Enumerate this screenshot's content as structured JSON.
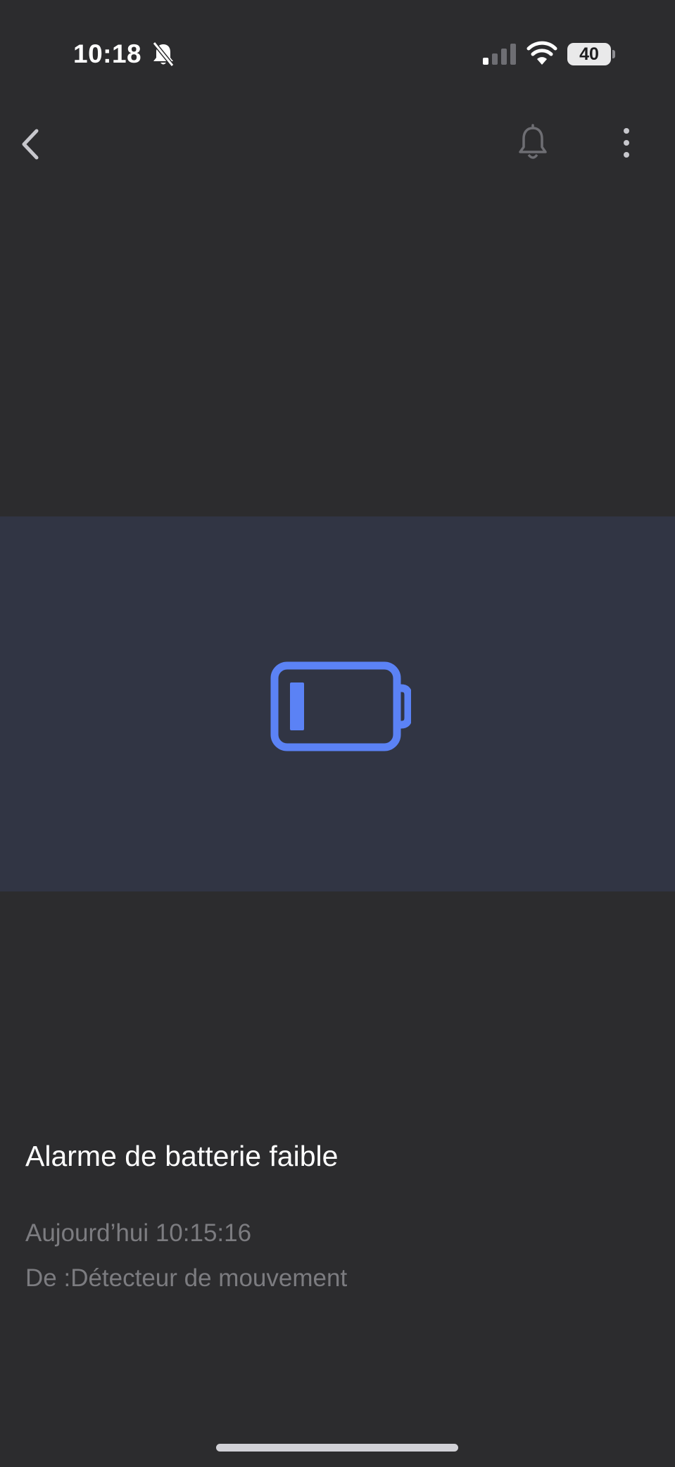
{
  "status_bar": {
    "time": "10:18",
    "battery_level": "40",
    "icons": [
      "mute-bell-icon",
      "signal-icon",
      "wifi-icon",
      "battery-icon"
    ]
  },
  "nav": {
    "icons": [
      "chevron-left-icon",
      "bell-icon",
      "more-vertical-icon"
    ]
  },
  "hero": {
    "icon": "low-battery-icon",
    "accent_color": "#5b82f5",
    "background_color": "#313544"
  },
  "alarm": {
    "title": "Alarme de batterie faible",
    "time": "Aujourd’hui 10:15:16",
    "source": "De :Détecteur de mouvement"
  }
}
